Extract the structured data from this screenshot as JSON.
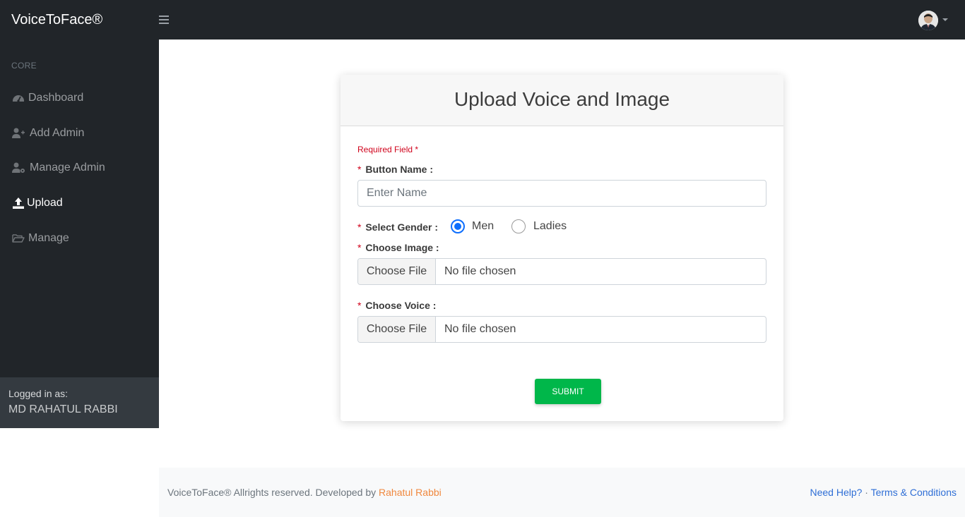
{
  "topbar": {
    "brand": "VoiceToFace®"
  },
  "sidebar": {
    "heading": "CORE",
    "items": [
      {
        "label": "Dashboard",
        "icon": "dashboard-icon"
      },
      {
        "label": "Add Admin",
        "icon": "user-plus-icon"
      },
      {
        "label": "Manage Admin",
        "icon": "user-cog-icon"
      },
      {
        "label": "Upload",
        "icon": "upload-icon",
        "active": true
      },
      {
        "label": "Manage",
        "icon": "folder-open-icon"
      }
    ],
    "footer": {
      "logged_in_label": "Logged in as:",
      "user_name": "MD RAHATUL RABBI"
    }
  },
  "form": {
    "title": "Upload Voice and Image",
    "required_note": "Required Field *",
    "button_name_label": "Button Name :",
    "button_name_placeholder": "Enter Name",
    "button_name_value": "",
    "gender_label": "Select Gender :",
    "gender_options": [
      "Men",
      "Ladies"
    ],
    "gender_selected": "Men",
    "image_label": "Choose Image :",
    "voice_label": "Choose Voice :",
    "file_button_label": "Choose File",
    "no_file_text": "No file chosen",
    "submit_label": "SUBMIT",
    "required_star": "*"
  },
  "footer": {
    "copyright": "VoiceToFace® Allrights reserved. Developed by ",
    "author": "Rahatul Rabbi",
    "help_link": "Need Help?",
    "separator": " · ",
    "terms_link": "Terms & Conditions"
  },
  "colors": {
    "sidebar_bg": "#212529",
    "accent_blue": "#0d6efd",
    "submit_green": "#00b74a",
    "required_red": "#d0021b",
    "author_orange": "#f0883e"
  }
}
